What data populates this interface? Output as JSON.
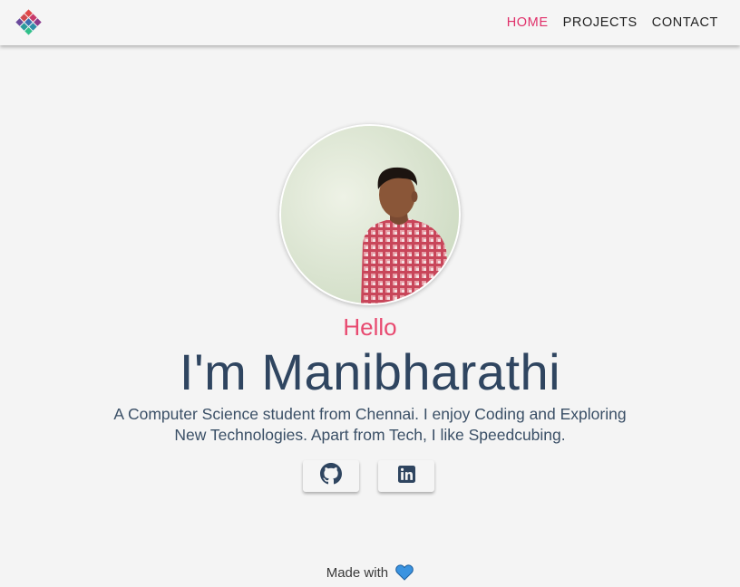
{
  "navbar": {
    "logo_icon": "diamond-grid-logo-icon",
    "links": [
      {
        "label": "HOME",
        "active": true
      },
      {
        "label": "PROJECTS",
        "active": false
      },
      {
        "label": "CONTACT",
        "active": false
      }
    ]
  },
  "hero": {
    "avatar_icon": "profile-photo",
    "greeting": "Hello",
    "name": "I'm Manibharathi",
    "bio": "A Computer Science student from Chennai. I enjoy Coding and Exploring New Technologies. Apart from Tech, I like Speedcubing.",
    "social": [
      {
        "icon": "github-icon"
      },
      {
        "icon": "linkedin-icon"
      }
    ]
  },
  "footer": {
    "text": "Made with",
    "heart_icon": "heart-icon"
  },
  "colors": {
    "accent": "#e0306a",
    "greeting": "#e84a70",
    "heading": "#2f4560",
    "background": "#f4f4f4",
    "heart": "#2f86d6"
  }
}
